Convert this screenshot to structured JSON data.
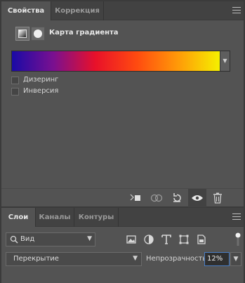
{
  "properties_panel": {
    "tabs": [
      {
        "label": "Свойства",
        "active": true
      },
      {
        "label": "Коррекция",
        "active": false
      }
    ],
    "adjustment_title": "Карта градиента",
    "gradient": {
      "stops": [
        "#1a0aa6",
        "#7a1090",
        "#e8102a",
        "#ff4a10",
        "#ff9a08",
        "#f5f000"
      ]
    },
    "checkboxes": [
      {
        "label": "Дизеринг",
        "checked": false
      },
      {
        "label": "Инверсия",
        "checked": false
      }
    ],
    "toolbar_icons": [
      "clip-to-layer-icon",
      "view-previous-state-icon",
      "reset-icon",
      "visibility-eye-icon",
      "trash-icon"
    ]
  },
  "layers_panel": {
    "tabs": [
      {
        "label": "Слои",
        "active": true
      },
      {
        "label": "Каналы",
        "active": false
      },
      {
        "label": "Контуры",
        "active": false
      }
    ],
    "filter": {
      "label": "Вид",
      "icon": "search-icon"
    },
    "filter_icons": [
      "pixel-layer-filter-icon",
      "adjustment-layer-filter-icon",
      "type-layer-filter-icon",
      "shape-layer-filter-icon",
      "smart-object-filter-icon"
    ],
    "blend_mode": "Перекрытие",
    "opacity_label": "Непрозрачность:",
    "opacity_value": "12%"
  },
  "colors": {
    "panel_bg": "#535353",
    "tab_bar_bg": "#424242",
    "accent_focus": "#4a7ec4"
  }
}
